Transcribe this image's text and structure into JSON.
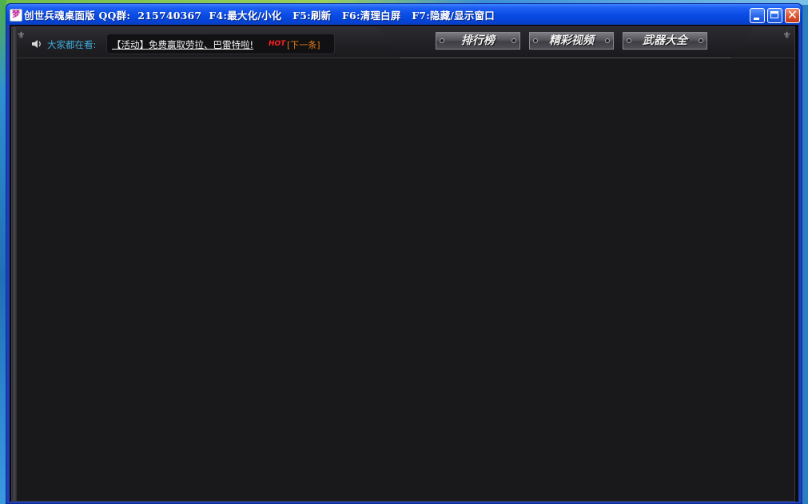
{
  "window": {
    "app_icon_glyph": "梦",
    "title": "创世兵魂桌面版 QQ群:  215740367  F4:最大化/小化   F5:刷新   F6:清理白屏   F7:隐藏/显示窗口"
  },
  "topbar": {
    "watching_label": "大家都在看:",
    "news_link": "【活动】免费赢取劳拉、巴雷特啦!",
    "hot_badge": "HOT",
    "next_link": "[下一条]"
  },
  "nav": {
    "ranking": "排行榜",
    "videos": "精彩视频",
    "weapons": "武器大全"
  },
  "colors": {
    "titlebar": "#0a4de6",
    "client_bg": "#19191c",
    "watching_label": "#3fa9d8",
    "hot_badge": "#ff2020",
    "next_link": "#e07a10"
  }
}
